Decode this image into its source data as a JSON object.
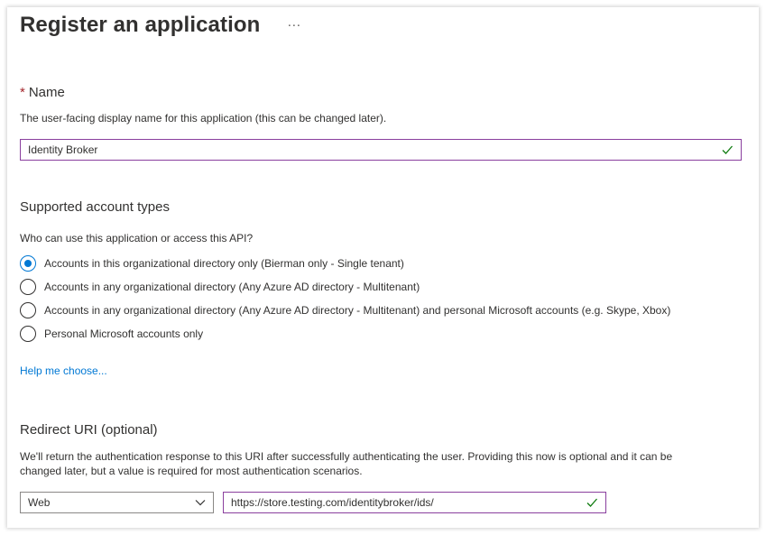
{
  "header": {
    "title": "Register an application",
    "more_label": "···"
  },
  "name_section": {
    "required_marker": "*",
    "label": "Name",
    "description": "The user-facing display name for this application (this can be changed later).",
    "value": "Identity Broker"
  },
  "account_types": {
    "label": "Supported account types",
    "question": "Who can use this application or access this API?",
    "options": [
      {
        "label": "Accounts in this organizational directory only (Bierman only - Single tenant)",
        "selected": true
      },
      {
        "label": "Accounts in any organizational directory (Any Azure AD directory - Multitenant)",
        "selected": false
      },
      {
        "label": "Accounts in any organizational directory (Any Azure AD directory - Multitenant) and personal Microsoft accounts (e.g. Skype, Xbox)",
        "selected": false
      },
      {
        "label": "Personal Microsoft accounts only",
        "selected": false
      }
    ],
    "help_link": "Help me choose..."
  },
  "redirect": {
    "label": "Redirect URI (optional)",
    "description_line1": "We'll return the authentication response to this URI after successfully authenticating the user. Providing this now is optional and it can be",
    "description_line2": "changed later, but a value is required for most authentication scenarios.",
    "platform": "Web",
    "uri": "https://store.testing.com/identitybroker/ids/"
  },
  "colors": {
    "accent": "#0078d4",
    "input_border": "#8a3f9e",
    "valid_check": "#107c10",
    "required": "#a4262c"
  },
  "icons": {
    "more": "ellipsis-icon",
    "valid": "checkmark-icon",
    "dropdown": "chevron-down-icon"
  }
}
